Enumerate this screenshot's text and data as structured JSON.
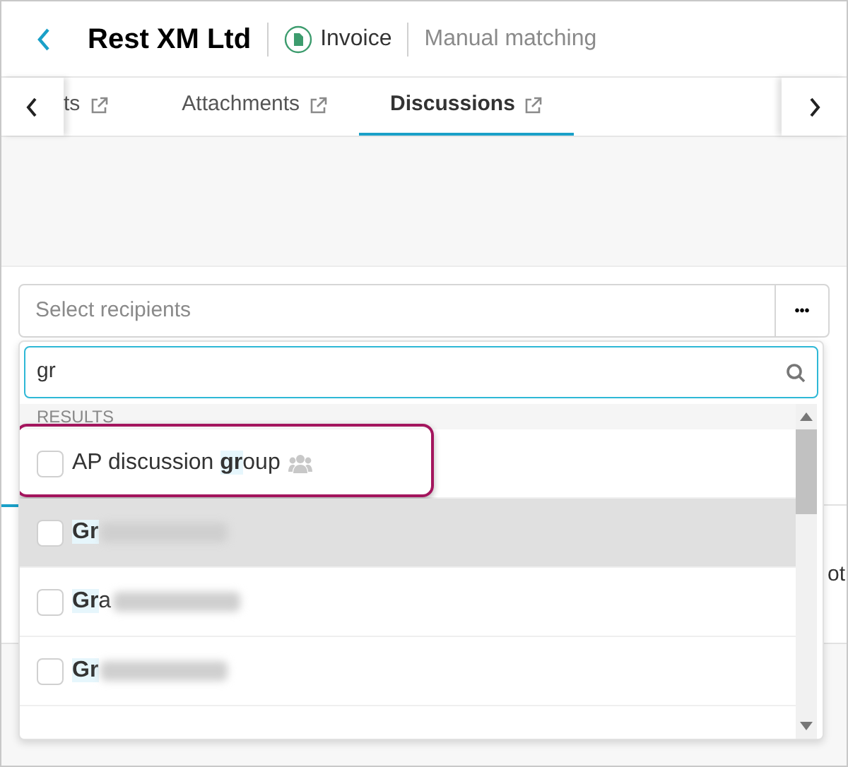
{
  "header": {
    "title": "Rest XM Ltd",
    "document_type": "Invoice",
    "mode": "Manual matching"
  },
  "tabs": [
    {
      "label": "ts",
      "selected": false
    },
    {
      "label": "Attachments",
      "selected": false
    },
    {
      "label": "Discussions",
      "selected": true
    }
  ],
  "recipients": {
    "placeholder": "Select recipients",
    "more_button": "•••"
  },
  "dropdown": {
    "search_value": "gr",
    "results_heading": "RESULTS",
    "results": [
      {
        "kind": "group",
        "before": "AP discussion ",
        "match": "gr",
        "after": "oup",
        "checked": false,
        "hovered": false,
        "outlined": true
      },
      {
        "kind": "person",
        "match": "Gr",
        "checked": false,
        "hovered": true,
        "outlined": false
      },
      {
        "kind": "person",
        "match": "Gr",
        "after": "a",
        "checked": false,
        "hovered": false,
        "outlined": false
      },
      {
        "kind": "person",
        "match": "Gr",
        "checked": false,
        "hovered": false,
        "outlined": false
      }
    ]
  },
  "background_row": {
    "text": "ot"
  }
}
